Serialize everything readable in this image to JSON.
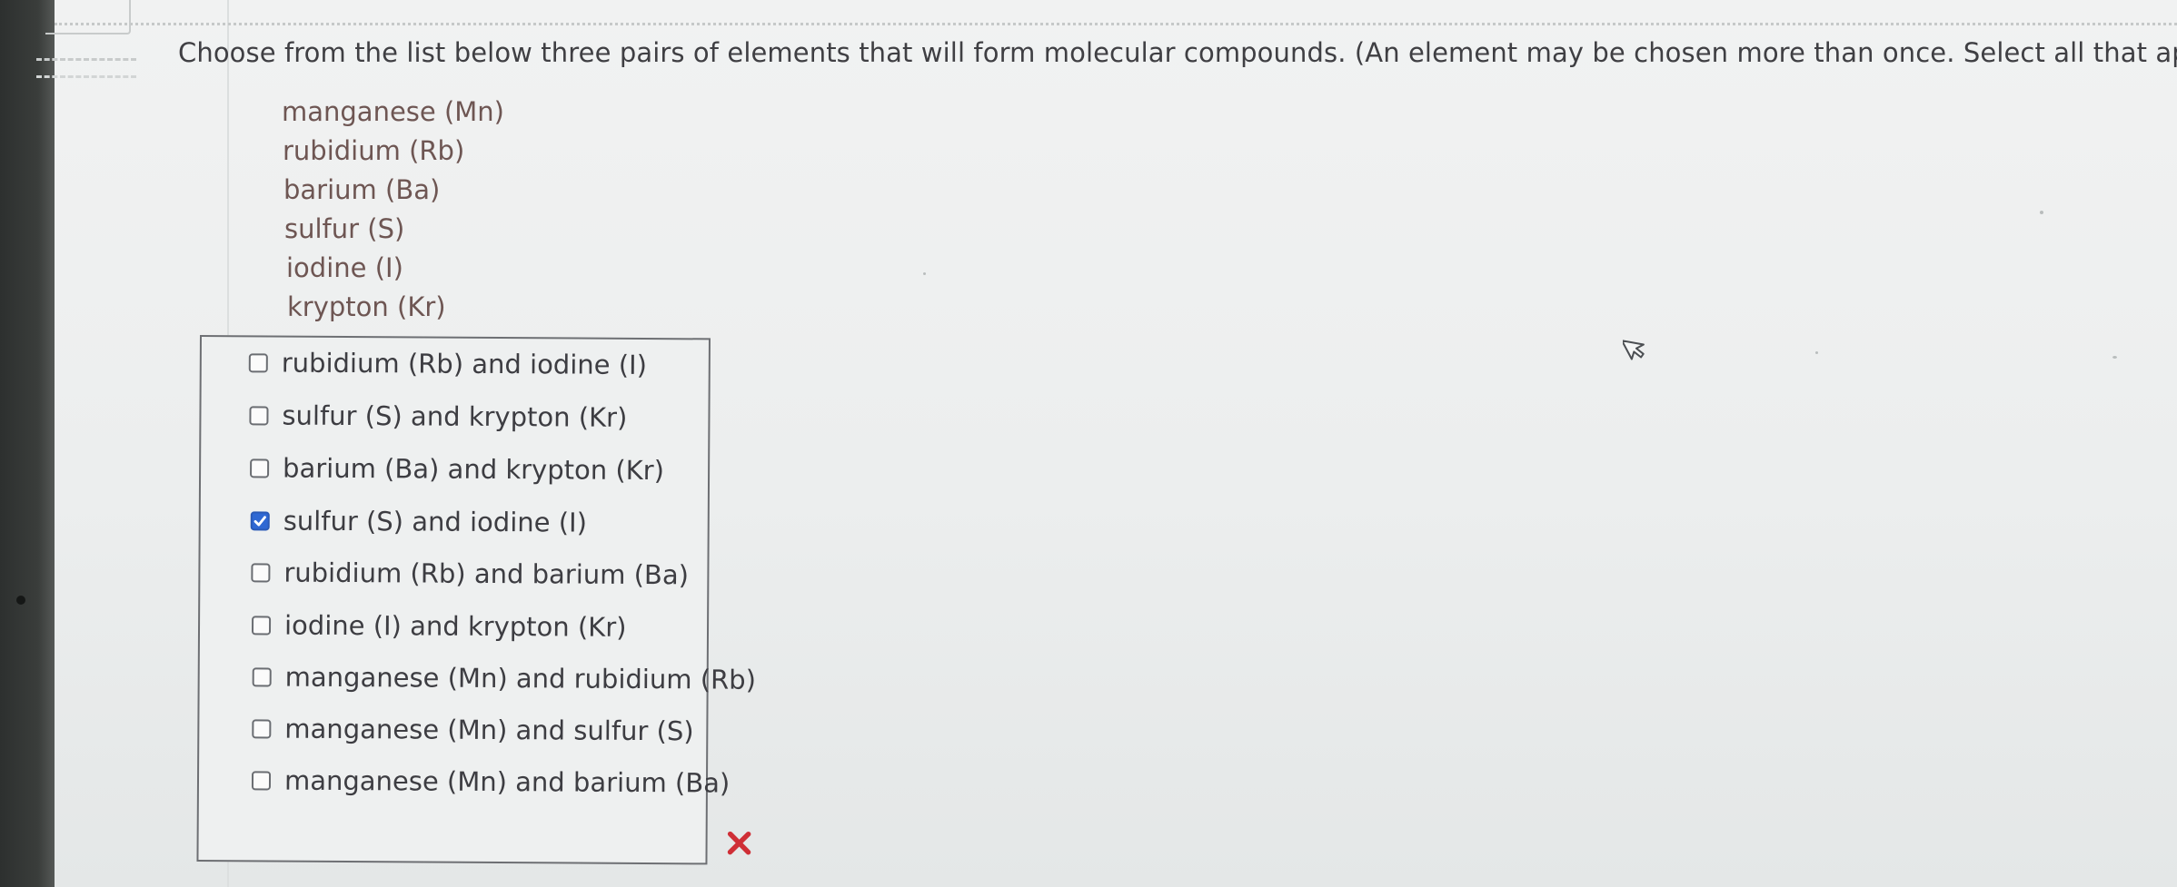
{
  "question": {
    "text": "Choose from the list below three pairs of elements that will form molecular compounds. (An element may be chosen more than once. Select all that apply.)"
  },
  "elements": [
    "manganese (Mn)",
    "rubidium (Rb)",
    "barium (Ba)",
    "sulfur (S)",
    "iodine (I)",
    "krypton (Kr)"
  ],
  "options": [
    {
      "label": "rubidium (Rb) and iodine (I)",
      "checked": false
    },
    {
      "label": "sulfur (S) and krypton (Kr)",
      "checked": false
    },
    {
      "label": "barium (Ba) and krypton (Kr)",
      "checked": false
    },
    {
      "label": "sulfur (S) and iodine (I)",
      "checked": true
    },
    {
      "label": "rubidium (Rb) and barium (Ba)",
      "checked": false
    },
    {
      "label": "iodine (I) and krypton (Kr)",
      "checked": false
    },
    {
      "label": "manganese (Mn) and rubidium (Rb)",
      "checked": false
    },
    {
      "label": "manganese (Mn) and sulfur (S)",
      "checked": false
    },
    {
      "label": "manganese (Mn) and barium (Ba)",
      "checked": false
    }
  ],
  "icons": {
    "clear": "close-x-icon",
    "cursor": "mouse-pointer-icon",
    "check": "checkmark-icon"
  },
  "colors": {
    "checked_box": "#2f68d3",
    "close_mark": "#cf2f36",
    "element_text": "#6e5653"
  }
}
